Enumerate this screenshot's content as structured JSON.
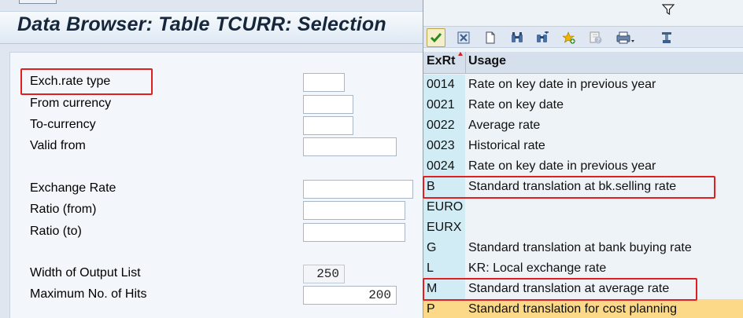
{
  "window": {
    "title": "Data Browser: Table TCURR: Selection"
  },
  "selection": {
    "fields": [
      {
        "label": "Exch.rate type",
        "value": ""
      },
      {
        "label": "From currency",
        "value": ""
      },
      {
        "label": "To-currency",
        "value": ""
      },
      {
        "label": "Valid from",
        "value": ""
      },
      {
        "label": "Exchange Rate",
        "value": ""
      },
      {
        "label": "Ratio (from)",
        "value": ""
      },
      {
        "label": "Ratio (to)",
        "value": ""
      },
      {
        "label": "Width of Output List",
        "value": "250"
      },
      {
        "label": "Maximum No. of Hits",
        "value": "200"
      }
    ]
  },
  "value_help": {
    "toolbar": [
      "continue-icon",
      "cancel-icon",
      "new-document-icon",
      "find-icon",
      "find-next-icon",
      "add-favorite-icon",
      "help-icon",
      "print-icon",
      "personalize-icon"
    ],
    "columns": [
      "ExRt",
      "Usage"
    ],
    "rows": [
      {
        "key": "0014",
        "usage": "Rate on key date in previous year"
      },
      {
        "key": "0021",
        "usage": "Rate on key date"
      },
      {
        "key": "0022",
        "usage": "Average rate"
      },
      {
        "key": "0023",
        "usage": "Historical rate"
      },
      {
        "key": "0024",
        "usage": "Rate on key date in previous year"
      },
      {
        "key": "B",
        "usage": "Standard translation at bk.selling rate"
      },
      {
        "key": "EURO",
        "usage": ""
      },
      {
        "key": "EURX",
        "usage": ""
      },
      {
        "key": "G",
        "usage": "Standard translation at bank buying rate"
      },
      {
        "key": "L",
        "usage": "KR: Local exchange rate"
      },
      {
        "key": "M",
        "usage": "Standard translation at average rate"
      },
      {
        "key": "P",
        "usage": "Standard translation for cost planning"
      }
    ],
    "selected_row_key": "P",
    "colors": {
      "selected_row": "#fbd988",
      "key_column": "#d1ecf5",
      "highlight_box": "#e02020"
    }
  }
}
